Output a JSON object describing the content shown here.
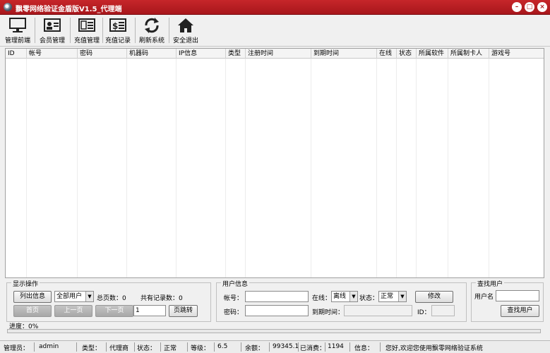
{
  "window": {
    "title": "飘零网络验证金盾版V1.5_代理端",
    "buttons": {
      "minimize": "–",
      "maximize": "□",
      "close": "×"
    }
  },
  "toolbar": {
    "items": [
      {
        "label": "管理前端",
        "icon": "monitor-icon"
      },
      {
        "label": "会员管理",
        "icon": "member-card-icon"
      },
      {
        "label": "充值管理",
        "icon": "panel-icon"
      },
      {
        "label": "充值记录",
        "icon": "dollar-list-icon"
      },
      {
        "label": "刷新系统",
        "icon": "refresh-icon"
      },
      {
        "label": "安全退出",
        "icon": "home-icon"
      }
    ]
  },
  "grid": {
    "columns": [
      "ID",
      "帐号",
      "密码",
      "机器码",
      "IP信息",
      "类型",
      "注册时间",
      "到期时间",
      "在线",
      "状态",
      "所属软件",
      "所属制卡人",
      "游戏号"
    ],
    "rows": []
  },
  "display_panel": {
    "title": "显示操作",
    "list_button": "列出信息",
    "filter_value": "全部用户",
    "total_pages_label": "总页数：0",
    "total_records_label": "共有记录数：0",
    "first_page": "首页",
    "prev_page": "上一页",
    "next_page": "下一页",
    "page_input": "1",
    "jump_button": "页跳转"
  },
  "user_panel": {
    "title": "用户信息",
    "account_label": "帐号：",
    "account_value": "",
    "password_label": "密码：",
    "password_value": "",
    "online_label": "在线：",
    "online_value": "离线",
    "status_label": "状态：",
    "status_value": "正常",
    "modify_button": "修改",
    "expire_label": "到期时间：",
    "expire_value": "",
    "id_label": "ID：",
    "id_value": ""
  },
  "search_panel": {
    "title": "查找用户",
    "username_label": "用户名",
    "username_value": "",
    "search_button": "查找用户"
  },
  "progress": {
    "label": "进度：0%",
    "value": 0
  },
  "status_bar": {
    "manager_label": "管理员：",
    "manager_value": "admin",
    "type_label": "类型：",
    "type_value": "代理商",
    "state_label": "状态：",
    "state_value": "正常",
    "level_label": "等级：",
    "level_value": "6.5",
    "balance_label": "余额：",
    "balance_value": "99345.1",
    "spent_label": "已消费：",
    "spent_value": "1194",
    "info_label": "信息：",
    "info_value": "您好,欢迎您使用飘零网络验证系统"
  },
  "colors": {
    "titlebar": "#b01a1f",
    "progress": "#3a9a3a"
  }
}
